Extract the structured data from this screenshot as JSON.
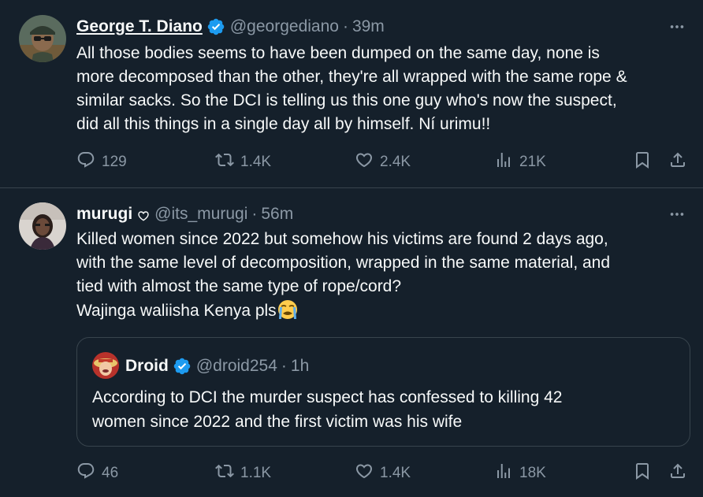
{
  "colors": {
    "background": "#15202b",
    "text": "#f7f9f9",
    "secondary": "#8b98a5",
    "border": "#38444d",
    "verified": "#1d9bf0"
  },
  "icons": [
    "verified-badge-icon",
    "more-icon",
    "reply-icon",
    "retweet-icon",
    "like-icon",
    "views-icon",
    "bookmark-icon",
    "share-icon",
    "heart-outline-icon",
    "crying-face-emoji"
  ],
  "tweets": [
    {
      "name": "George T. Diano",
      "handle": "@georgediano",
      "sep": "·",
      "time": "39m",
      "lines": [
        "All those bodies seems to have been dumped on the same day, none is",
        "more decomposed than the other, they're all wrapped with the same rope &",
        "similar sacks. So the DCI is telling us this one guy who's now the suspect,",
        "did all this things in a single day all by himself. Ní urimu!!"
      ],
      "stats": {
        "replies": "129",
        "retweets": "1.4K",
        "likes": "2.4K",
        "views": "21K"
      }
    },
    {
      "name": "murugi",
      "handle": "@its_murugi",
      "sep": "·",
      "time": "56m",
      "lines": [
        "Killed women since 2022 but somehow his victims are found 2 days ago,",
        "with the same level of decomposition, wrapped in the same material, and",
        "tied with almost the same type of rope/cord?",
        "Wajinga waliisha Kenya pls"
      ],
      "quote": {
        "name": "Droid",
        "handle": "@droid254",
        "sep": "·",
        "time": "1h",
        "lines": [
          "According to DCI the murder suspect has confessed to killing 42",
          "women since 2022 and the first victim was his wife"
        ]
      },
      "stats": {
        "replies": "46",
        "retweets": "1.1K",
        "likes": "1.4K",
        "views": "18K"
      }
    }
  ]
}
